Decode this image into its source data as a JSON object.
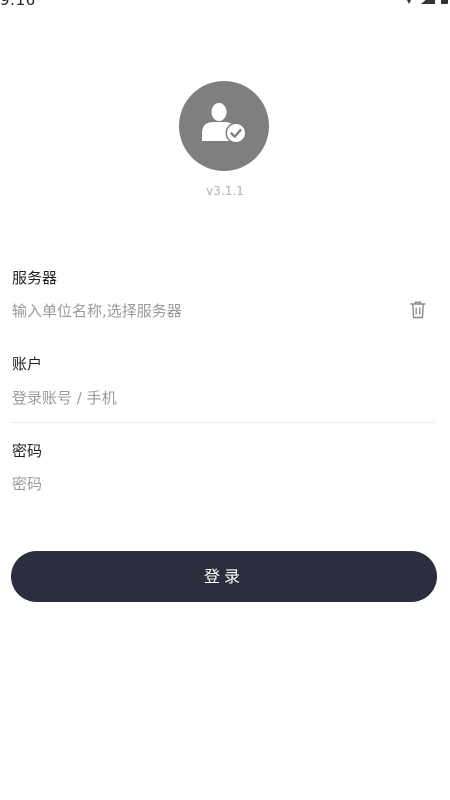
{
  "status_bar": {
    "time": "9:16"
  },
  "app": {
    "version": "v3.1.1",
    "avatar_icon": "user-verified-icon",
    "accent_color": "#2b2f3d"
  },
  "server": {
    "label": "服务器",
    "placeholder": "输入单位名称,选择服务器",
    "value": "",
    "clear_icon": "trash-icon"
  },
  "account": {
    "label": "账户",
    "placeholder": "登录账号 / 手机",
    "value": ""
  },
  "password": {
    "label": "密码",
    "placeholder": "密码",
    "value": ""
  },
  "login_button": {
    "label": "登录"
  }
}
